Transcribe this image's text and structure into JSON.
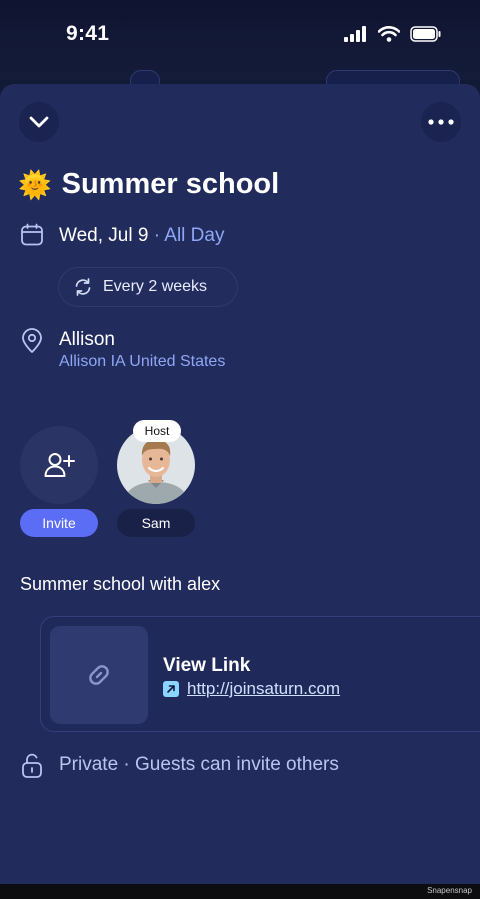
{
  "status_bar": {
    "time": "9:41"
  },
  "event": {
    "emoji": "🌞",
    "title": "Summer school",
    "date": "Wed, Jul 9",
    "separator": " · ",
    "all_day": "All Day",
    "recurrence": "Every 2 weeks",
    "location_name": "Allison",
    "location_address": "Allison IA United States",
    "description": "Summer school with alex"
  },
  "guests": {
    "invite_label": "Invite",
    "host_badge": "Host",
    "host_name": "Sam"
  },
  "link": {
    "title": "View Link",
    "url": "http://joinsaturn.com"
  },
  "privacy": {
    "label": "Private · ",
    "detail": "Guests can invite others"
  },
  "footer": {
    "watermark": "Snapensnap"
  },
  "colors": {
    "sheet_bg": "#212b5c",
    "accent": "#5b6cf5",
    "muted_text": "#8fa7f5"
  },
  "icons": [
    "chevron-down-icon",
    "more-icon",
    "calendar-icon",
    "repeat-icon",
    "location-pin-icon",
    "add-user-icon",
    "link-icon",
    "external-link-icon",
    "unlock-icon"
  ]
}
